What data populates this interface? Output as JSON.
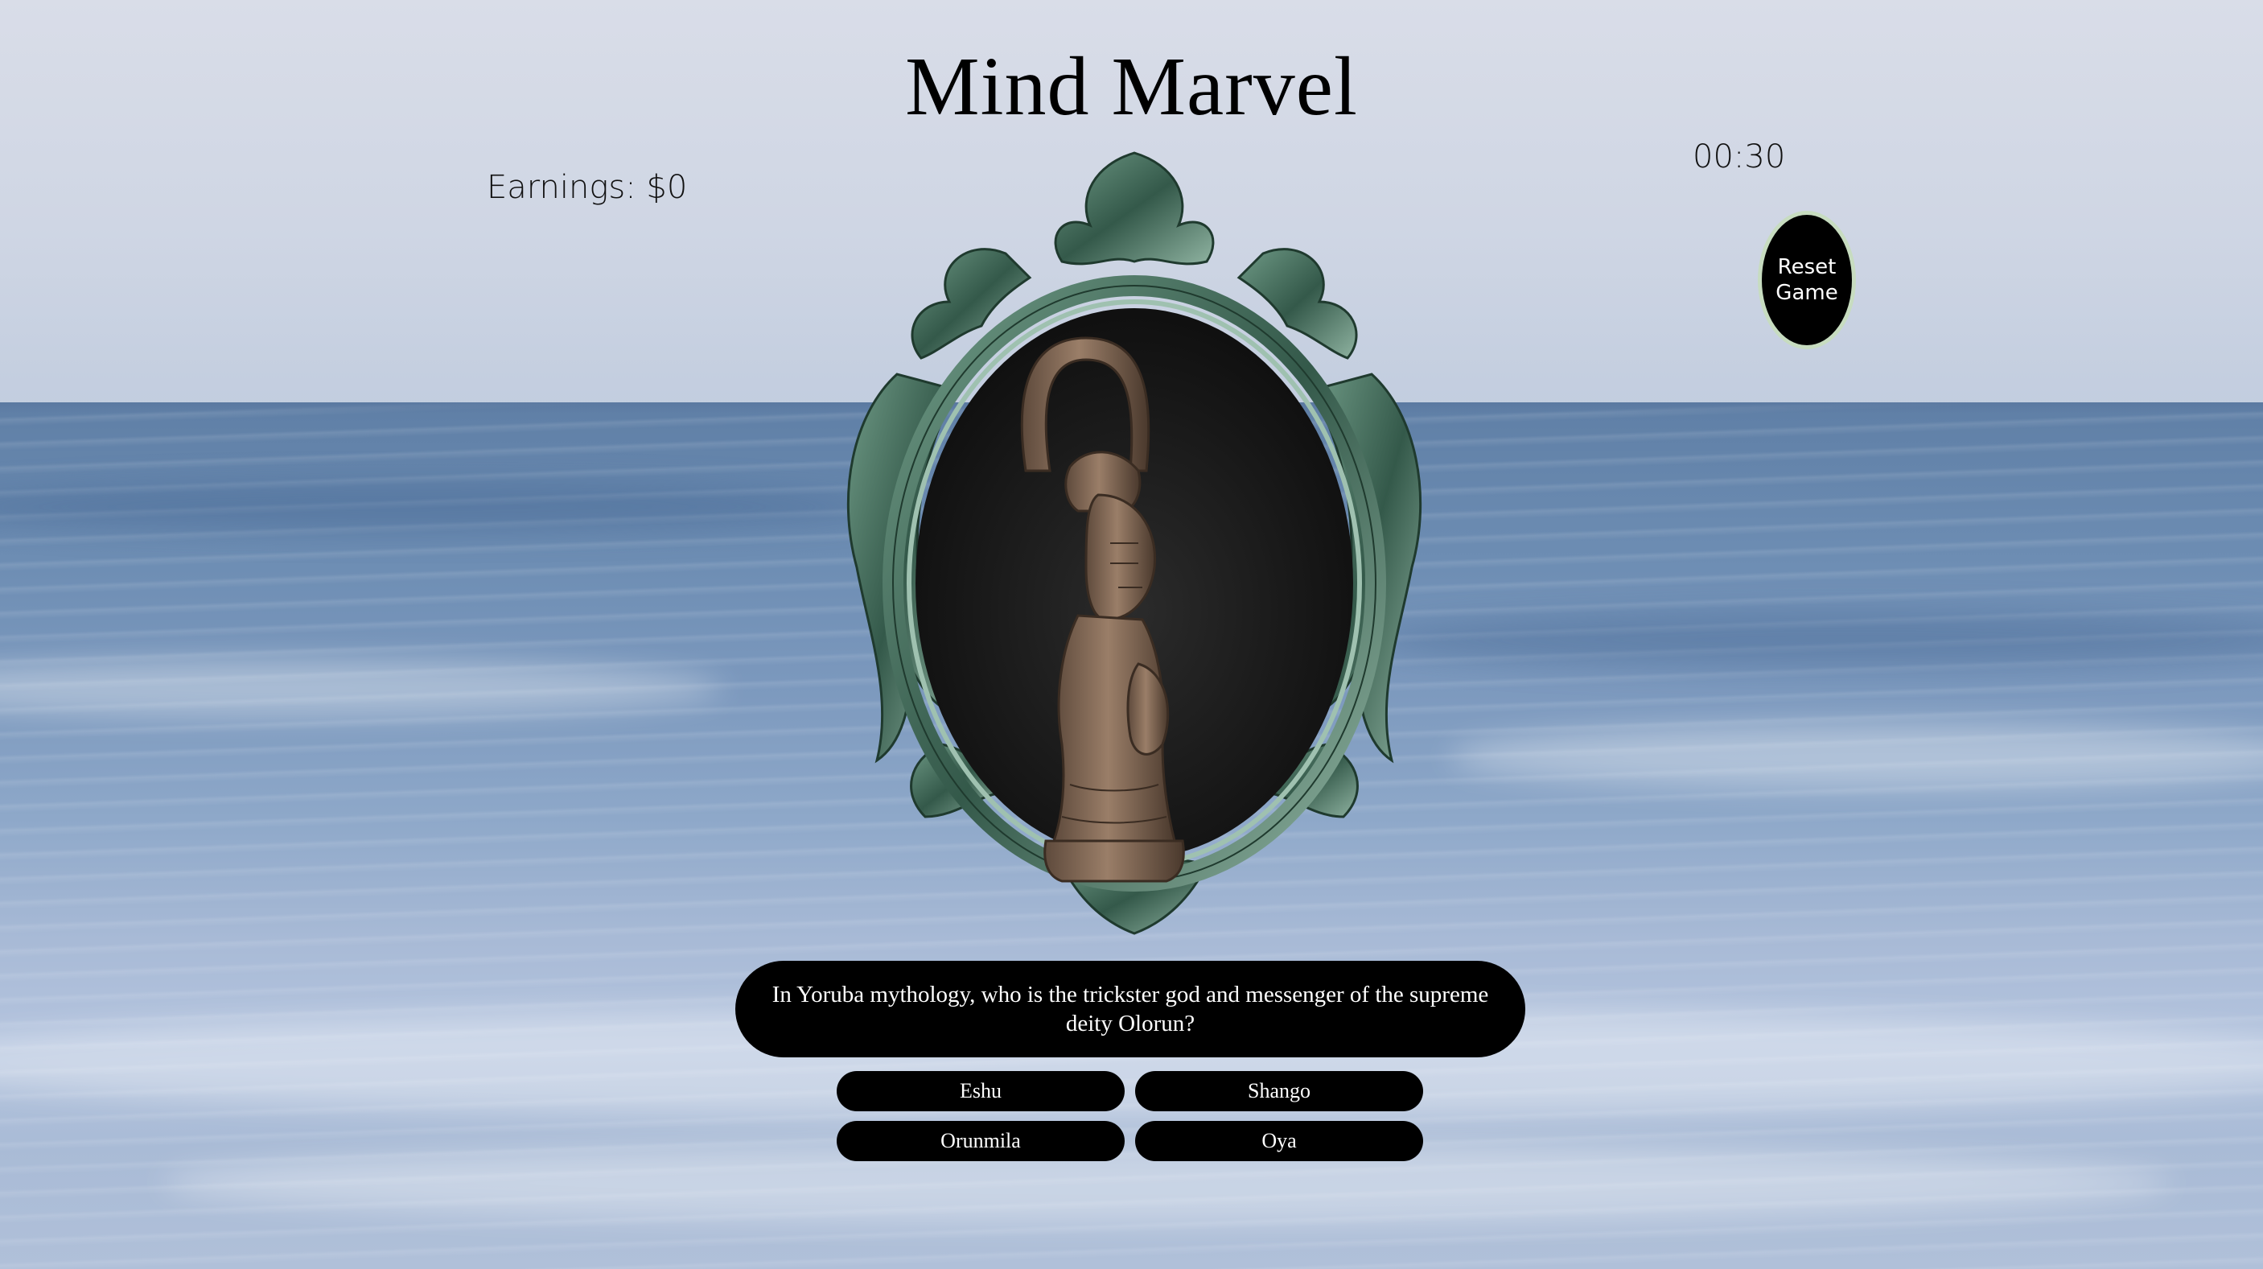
{
  "game": {
    "title": "Mind Marvel",
    "earnings": "Earnings: $0",
    "timer": "00:30",
    "reset_label_line1": "Reset",
    "reset_label_line2": "Game"
  },
  "question": {
    "text": "In Yoruba mythology, who is the trickster god and messenger of the supreme deity Olorun?"
  },
  "answers": [
    "Eshu",
    "Shango",
    "Orunmila",
    "Oya"
  ],
  "image": {
    "subject": "carved wooden Yoruba figure in ornate green oval frame"
  },
  "colors": {
    "button_bg": "#000000",
    "button_text": "#ffffff",
    "reset_border": "#c7dcc0",
    "frame": "#3f6a57"
  }
}
